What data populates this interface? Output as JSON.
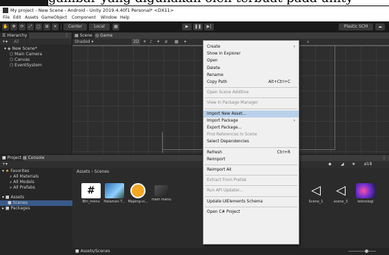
{
  "caption": "gambar yang digunakan oleh terbuat pada unity",
  "title": "My project - New Scene - Android - Unity 2019.4.40f1 Personal* <DX11>",
  "menubar": [
    "File",
    "Edit",
    "Assets",
    "GameObject",
    "Component",
    "Window",
    "Help"
  ],
  "toolbar": {
    "pivot_label": "Center",
    "space_label": "Local",
    "plastic_label": "Plastic SCM"
  },
  "hierarchy": {
    "tab": "Hierarchy",
    "search_placeholder": "All",
    "items": [
      {
        "label": "New Scene*"
      },
      {
        "label": "Main Camera"
      },
      {
        "label": "Canvas"
      },
      {
        "label": "EventSystem"
      }
    ]
  },
  "scene": {
    "tabs": [
      "Scene",
      "Game"
    ],
    "shading": "Shaded",
    "mode_2d": "2D"
  },
  "project": {
    "tabs": [
      "Project",
      "Console"
    ],
    "favorites_label": "Favorites",
    "favorites": [
      "All Materials",
      "All Models",
      "All Prefabs"
    ],
    "assets_label": "Assets",
    "scenes_label": "Scenes",
    "packages_label": "Packages",
    "breadcrumb": [
      "Assets",
      "Scenes"
    ],
    "path_footer": "Assets/Scenes",
    "assets_left": [
      {
        "label": "Btn_menu",
        "kind": "script"
      },
      {
        "label": "Halaman T...",
        "kind": "image"
      },
      {
        "label": "Maping-vi...",
        "kind": "circle"
      },
      {
        "label": "main menu",
        "kind": "cube"
      }
    ],
    "assets_right": [
      {
        "label": "Scene_1",
        "kind": "unity"
      },
      {
        "label": "scene_3",
        "kind": "unity"
      },
      {
        "label": "teknologi",
        "kind": "image"
      }
    ],
    "visible_count": "18"
  },
  "context_menu": {
    "items": [
      {
        "label": "Create",
        "shortcut": "",
        "submenu": true,
        "disabled": false,
        "highlight": false
      },
      {
        "label": "Show in Explorer",
        "shortcut": "",
        "submenu": false,
        "disabled": false,
        "highlight": false
      },
      {
        "label": "Open",
        "shortcut": "",
        "submenu": false,
        "disabled": false,
        "highlight": false
      },
      {
        "label": "Delete",
        "shortcut": "",
        "submenu": false,
        "disabled": false,
        "highlight": false
      },
      {
        "label": "Rename",
        "shortcut": "",
        "submenu": false,
        "disabled": false,
        "highlight": false
      },
      {
        "label": "Copy Path",
        "shortcut": "Alt+Ctrl+C",
        "submenu": false,
        "disabled": false,
        "highlight": false
      },
      {
        "sep": true
      },
      {
        "label": "Open Scene Additive",
        "shortcut": "",
        "submenu": false,
        "disabled": true,
        "highlight": false
      },
      {
        "sep": true
      },
      {
        "label": "View in Package Manager",
        "shortcut": "",
        "submenu": false,
        "disabled": true,
        "highlight": false
      },
      {
        "sep": true
      },
      {
        "label": "Import New Asset...",
        "shortcut": "",
        "submenu": false,
        "disabled": false,
        "highlight": true
      },
      {
        "label": "Import Package",
        "shortcut": "",
        "submenu": true,
        "disabled": false,
        "highlight": false
      },
      {
        "label": "Export Package...",
        "shortcut": "",
        "submenu": false,
        "disabled": false,
        "highlight": false
      },
      {
        "label": "Find References In Scene",
        "shortcut": "",
        "submenu": false,
        "disabled": true,
        "highlight": false
      },
      {
        "label": "Select Dependencies",
        "shortcut": "",
        "submenu": false,
        "disabled": false,
        "highlight": false
      },
      {
        "sep": true
      },
      {
        "label": "Refresh",
        "shortcut": "Ctrl+R",
        "submenu": false,
        "disabled": false,
        "highlight": false
      },
      {
        "label": "Reimport",
        "shortcut": "",
        "submenu": false,
        "disabled": false,
        "highlight": false
      },
      {
        "sep": true
      },
      {
        "label": "Reimport All",
        "shortcut": "",
        "submenu": false,
        "disabled": false,
        "highlight": false
      },
      {
        "sep": true
      },
      {
        "label": "Extract From Prefab",
        "shortcut": "",
        "submenu": false,
        "disabled": true,
        "highlight": false
      },
      {
        "sep": true
      },
      {
        "label": "Run API Updater...",
        "shortcut": "",
        "submenu": false,
        "disabled": true,
        "highlight": false
      },
      {
        "sep": true
      },
      {
        "label": "Update UIElements Schema",
        "shortcut": "",
        "submenu": false,
        "disabled": false,
        "highlight": false
      },
      {
        "sep": true
      },
      {
        "label": "Open C# Project",
        "shortcut": "",
        "submenu": false,
        "disabled": false,
        "highlight": false
      }
    ]
  },
  "colors": {
    "accent": "#3a72b0",
    "highlight": "#b9d1ea",
    "panel": "#282828",
    "header": "#3c3c3c"
  }
}
